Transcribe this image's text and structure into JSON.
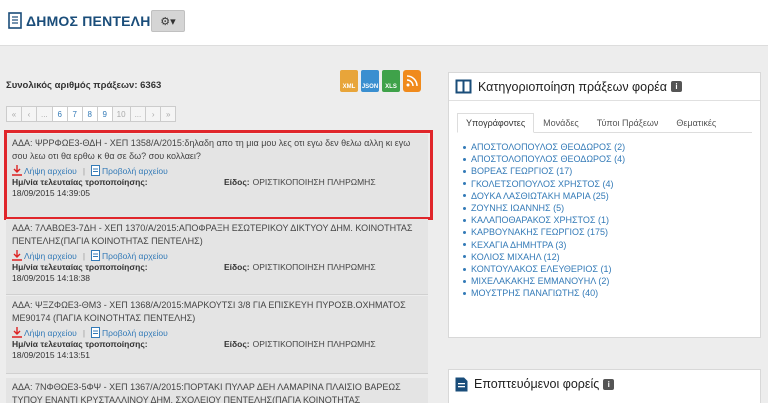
{
  "header": {
    "title": "ΔΗΜΟΣ ΠΕΝΤΕΛΗΣ",
    "settings_caret": "▾"
  },
  "left": {
    "total_label": "Συνολικός αριθμός πράξεων: 6363",
    "exports": [
      "XML",
      "JSON",
      "XLS"
    ],
    "pager": [
      "«",
      "‹",
      "...",
      "6",
      "7",
      "8",
      "9",
      "10",
      "...",
      "›",
      "»"
    ],
    "records": [
      {
        "ada": "ΑΔΑ: ΨΡΡΦΩΕ3-ΘΔΗ - ΧΕΠ 1358/Α/2015:δηλαδη απο τη μια μου λες οτι εγω δεν θελω αλλη κι εγω σου λεω οτι θα ερθω κ θα σε δω? σου κολλαει?",
        "download": "Λήψη αρχείου",
        "view": "Προβολή αρχείου",
        "modified_label": "Ημ/νία τελευταίας τροποποίησης:",
        "type_label": "Είδος:",
        "type_value": "ΟΡΙΣΤΙΚΟΠΟΙΗΣΗ ΠΛΗΡΩΜΗΣ",
        "date": "18/09/2015 14:39:05"
      },
      {
        "ada": "ΑΔΑ: 7ΛΑΒΩΕ3-7ΔΗ - ΧΕΠ 1370/Α/2015:ΑΠΟΦΡΑΞΗ ΕΣΩΤΕΡΙΚΟΥ ΔΙΚΤΥΟΥ ΔΗΜ. ΚΟΙΝΟΤΗΤΑΣ ΠΕΝΤΕΛΗΣ(ΠΑΓΙΑ ΚΟΙΝΟΤΗΤΑΣ ΠΕΝΤΕΛΗΣ)",
        "download": "Λήψη αρχείου",
        "view": "Προβολή αρχείου",
        "modified_label": "Ημ/νία τελευταίας τροποποίησης:",
        "type_label": "Είδος:",
        "type_value": "ΟΡΙΣΤΙΚΟΠΟΙΗΣΗ ΠΛΗΡΩΜΗΣ",
        "date": "18/09/2015 14:18:38"
      },
      {
        "ada": "ΑΔΑ: ΨΞΖΦΩΕ3-ΘΜ3 - ΧΕΠ 1368/Α/2015:ΜΑΡΚΟΥΤΣΙ 3/8 ΓΙΑ ΕΠΙΣΚΕΥΗ ΠΥΡΟΣΒ.ΟΧΗΜΑΤΟΣ ΜΕ90174 (ΠΑΓΙΑ ΚΟΙΝΟΤΗΤΑΣ ΠΕΝΤΕΛΗΣ)",
        "download": "Λήψη αρχείου",
        "view": "Προβολή αρχείου",
        "modified_label": "Ημ/νία τελευταίας τροποποίησης:",
        "type_label": "Είδος:",
        "type_value": "ΟΡΙΣΤΙΚΟΠΟΙΗΣΗ ΠΛΗΡΩΜΗΣ",
        "date": "18/09/2015 14:13:51"
      },
      {
        "ada": "ΑΔΑ: 7ΝΦΘΩΕ3-5ΦΨ - ΧΕΠ 1367/Α/2015:ΠΟΡΤΑΚΙ ΠΥΛΑΡ ΔΕΗ ΛΑΜΑΡΙΝΑ ΠΛΑΙΣΙΟ ΒΑΡΕΩΣ ΤΥΠΟΥ ΕΝΑΝΤΙ ΚΡΥΣΤΑΛΛΙΝΟΥ ΔΗΜ. ΣΧΟΛΕΙΟΥ ΠΕΝΤΕΛΗΣ(ΠΑΓΙΑ ΚΟΙΝΟΤΗΤΑΣ"
      }
    ]
  },
  "categories_panel": {
    "title": "Κατηγοριοποίηση πράξεων φορέα",
    "info": "i",
    "tabs": [
      "Υπογράφοντες",
      "Μονάδες",
      "Τύποι Πράξεων",
      "Θεματικές"
    ],
    "active_tab": 0,
    "signers": [
      "ΑΠΟΣΤΟΛΟΠΟΥΛΟΣ ΘΕΟΔΩΡΟΣ (2)",
      "ΑΠΟΣΤΟΛΟΠΟΥΛΟΣ ΘΕΟΔΩΡΟΣ (4)",
      "ΒΟΡΕΑΣ ΓΕΩΡΓΙΟΣ (17)",
      "ΓΚΟΛΕΤΣΟΠΟΥΛΟΣ ΧΡΗΣΤΟΣ (4)",
      "ΔΟΥΚΑ ΛΑΣΘΙΩΤΑΚΗ ΜΑΡΙΑ (25)",
      "ΖΟΥΝΗΣ ΙΩΑΝΝΗΣ (5)",
      "ΚΑΛΑΠΟΘΑΡΑΚΟΣ ΧΡΗΣΤΟΣ (1)",
      "ΚΑΡΒΟΥΝΑΚΗΣ ΓΕΩΡΓΙΟΣ (175)",
      "ΚΕΧΑΓΙΑ ΔΗΜΗΤΡΑ (3)",
      "ΚΟΛΙΟΣ ΜΙΧΑΗΛ (12)",
      "ΚΟΝΤΟΥΛΑΚΟΣ ΕΛΕΥΘΕΡΙΟΣ (1)",
      "ΜΙΧΕΛΑΚΑΚΗΣ ΕΜΜΑΝΟΥΗΛ (2)",
      "ΜΟΥΣΤΡΗΣ ΠΑΝΑΓΙΩΤΗΣ (40)"
    ]
  },
  "supervised_panel": {
    "title": "Εποπτευόμενοι φορείς",
    "info": "i"
  }
}
